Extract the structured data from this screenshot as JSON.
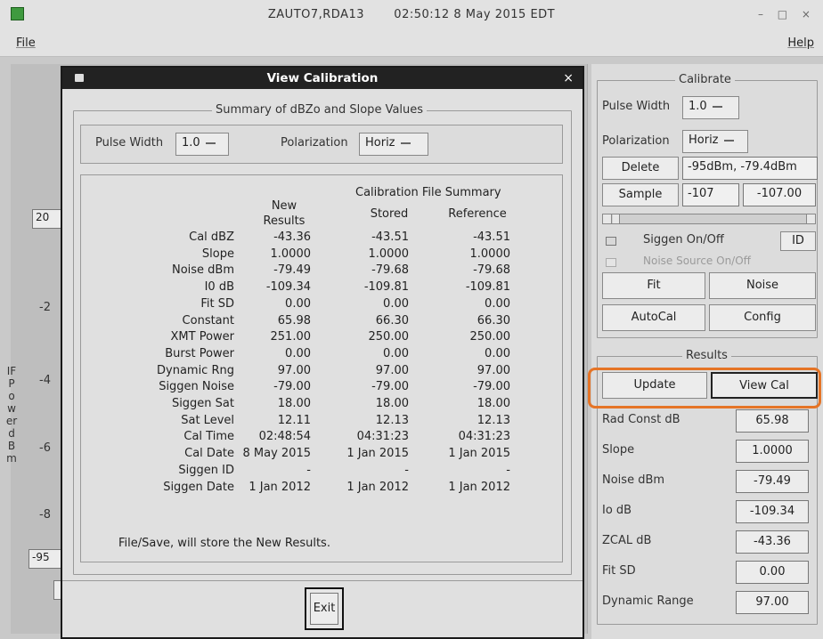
{
  "window": {
    "title": "ZAUTO7,RDA13",
    "clock": "02:50:12  8 May 2015 EDT",
    "controls": "– □ ×"
  },
  "menu": {
    "file": "File",
    "help": "Help"
  },
  "background": {
    "field_top": "20",
    "field_bottom": "-95",
    "y_ticks": [
      "-2",
      "-4",
      "-6",
      "-8"
    ],
    "y_axis_label": "IF Power dBm"
  },
  "dialog": {
    "title": "View Calibration",
    "close": "×",
    "group_label": "Summary of dBZo and Slope Values",
    "pulse_width_label": "Pulse Width",
    "pulse_width_value": "1.0",
    "polarization_label": "Polarization",
    "polarization_value": "Horiz",
    "summary_header": "Calibration File Summary",
    "col_new": "New\nResults",
    "col_stored": "Stored",
    "col_reference": "Reference",
    "rows": [
      {
        "label": "Cal dBZ",
        "new": "-43.36",
        "stored": "-43.51",
        "ref": "-43.51"
      },
      {
        "label": "Slope",
        "new": "1.0000",
        "stored": "1.0000",
        "ref": "1.0000"
      },
      {
        "label": "Noise dBm",
        "new": "-79.49",
        "stored": "-79.68",
        "ref": "-79.68"
      },
      {
        "label": "I0 dB",
        "new": "-109.34",
        "stored": "-109.81",
        "ref": "-109.81"
      },
      {
        "label": "Fit SD",
        "new": "0.00",
        "stored": "0.00",
        "ref": "0.00"
      },
      {
        "label": "Constant",
        "new": "65.98",
        "stored": "66.30",
        "ref": "66.30"
      },
      {
        "label": "XMT Power",
        "new": "251.00",
        "stored": "250.00",
        "ref": "250.00"
      },
      {
        "label": "Burst Power",
        "new": "0.00",
        "stored": "0.00",
        "ref": "0.00"
      },
      {
        "label": "Dynamic Rng",
        "new": "97.00",
        "stored": "97.00",
        "ref": "97.00"
      },
      {
        "label": "Siggen Noise",
        "new": "-79.00",
        "stored": "-79.00",
        "ref": "-79.00"
      },
      {
        "label": "Siggen Sat",
        "new": "18.00",
        "stored": "18.00",
        "ref": "18.00"
      },
      {
        "label": "Sat Level",
        "new": "12.11",
        "stored": "12.13",
        "ref": "12.13"
      },
      {
        "label": "Cal Time",
        "new": "02:48:54",
        "stored": "04:31:23",
        "ref": "04:31:23"
      },
      {
        "label": "Cal Date",
        "new": "8 May 2015",
        "stored": "1 Jan 2015",
        "ref": "1 Jan 2015"
      },
      {
        "label": "Siggen ID",
        "new": "-",
        "stored": "-",
        "ref": "-"
      },
      {
        "label": "Siggen Date",
        "new": "1 Jan 2012",
        "stored": "1 Jan 2012",
        "ref": "1 Jan 2012"
      }
    ],
    "footer_note": "File/Save, will store the New Results.",
    "exit_label": "Exit"
  },
  "calibrate": {
    "group_label": "Calibrate",
    "pulse_width_label": "Pulse Width",
    "pulse_width_value": "1.0",
    "polarization_label": "Polarization",
    "polarization_value": "Horiz",
    "delete_label": "Delete",
    "delete_value": "-95dBm, -79.4dBm",
    "sample_label": "Sample",
    "sample_value_1": "-107",
    "sample_value_2": "-107.00",
    "siggen_label": "Siggen On/Off",
    "id_label": "ID",
    "noise_source_label": "Noise Source On/Off",
    "fit_label": "Fit",
    "noise_label": "Noise",
    "autocal_label": "AutoCal",
    "config_label": "Config"
  },
  "results": {
    "group_label": "Results",
    "update_label": "Update",
    "view_cal_label": "View Cal",
    "rows": [
      {
        "label": "Rad Const dB",
        "value": "65.98"
      },
      {
        "label": "Slope",
        "value": "1.0000"
      },
      {
        "label": "Noise dBm",
        "value": "-79.49"
      },
      {
        "label": "Io dB",
        "value": "-109.34"
      },
      {
        "label": "ZCAL dB",
        "value": "-43.36"
      },
      {
        "label": "Fit SD",
        "value": "0.00"
      },
      {
        "label": "Dynamic Range",
        "value": "97.00"
      }
    ],
    "highlight_color": "#e57426"
  }
}
